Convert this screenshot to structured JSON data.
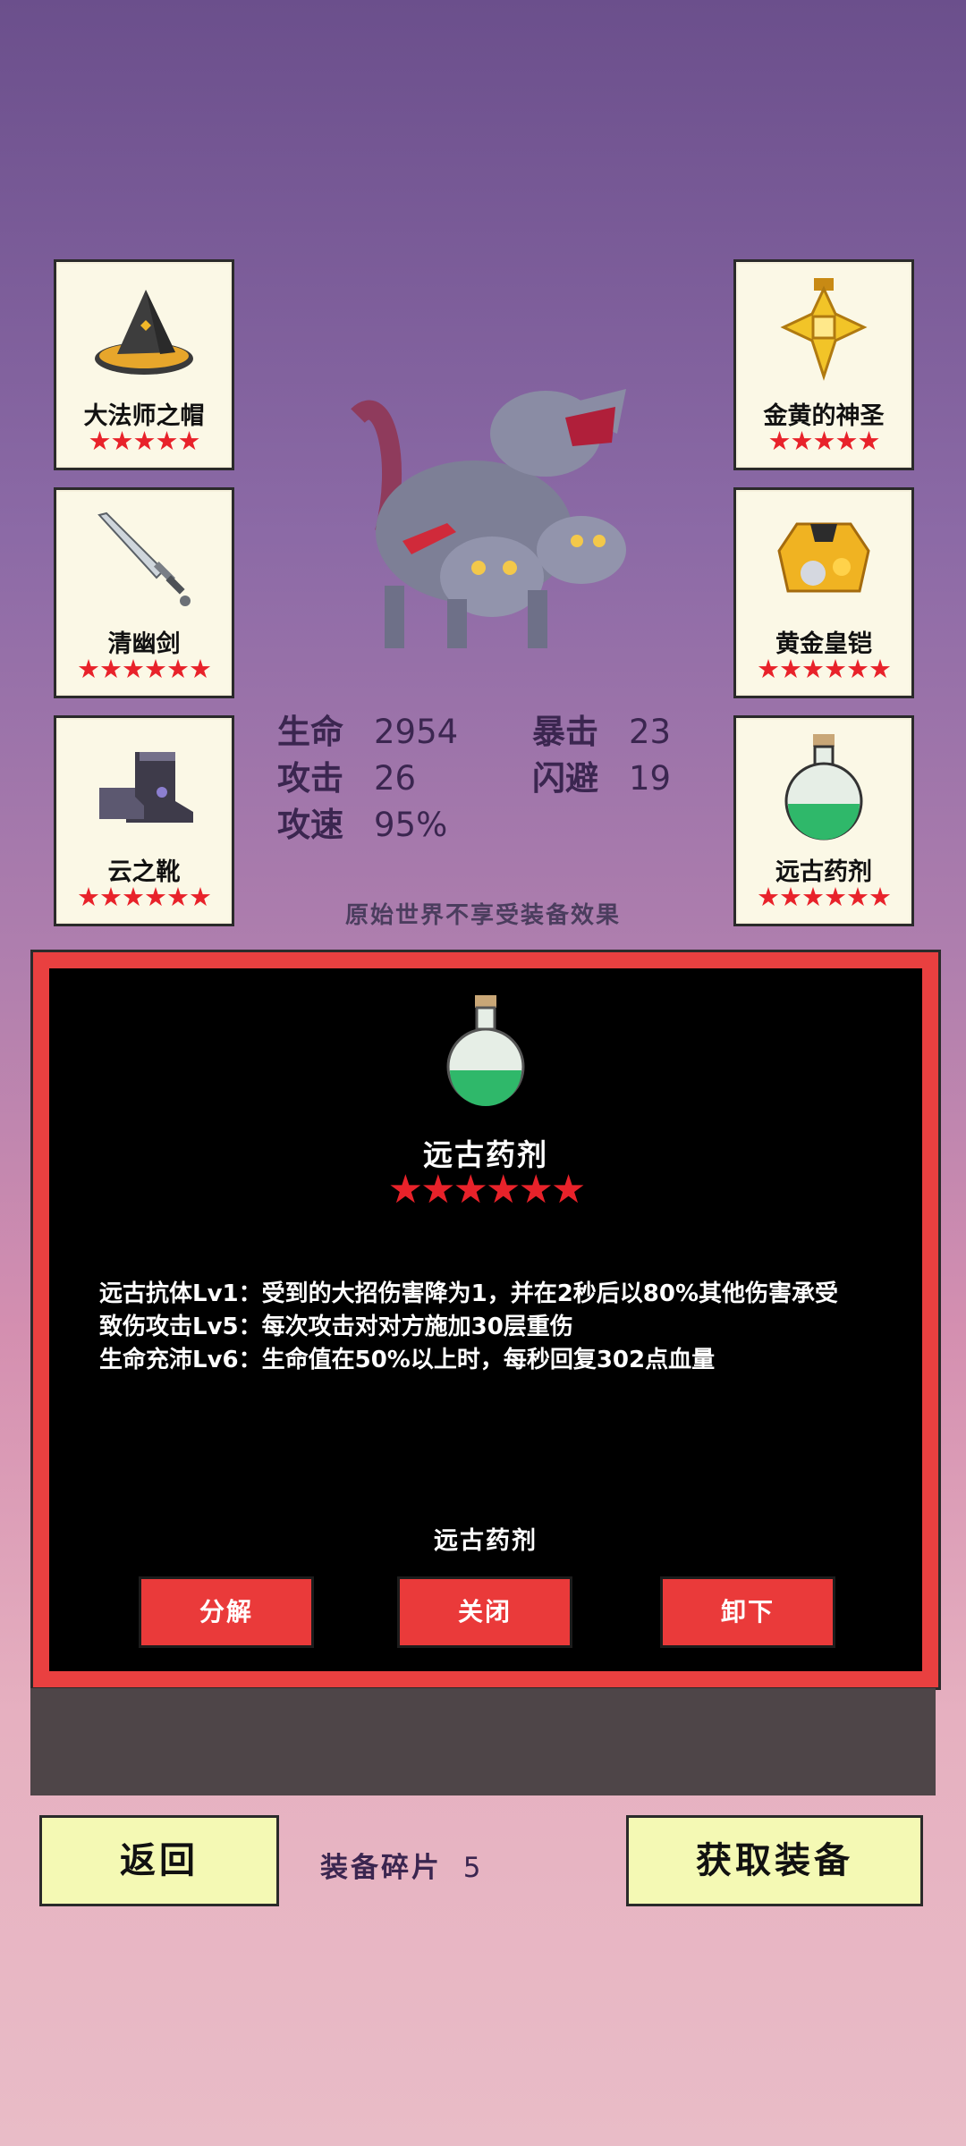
{
  "equipment_left": [
    {
      "name": "大法师之帽",
      "stars": "★★★★★",
      "icon": "wizard-hat-icon"
    },
    {
      "name": "清幽剑",
      "stars": "★★★★★★",
      "icon": "sword-icon"
    },
    {
      "name": "云之靴",
      "stars": "★★★★★★",
      "icon": "boots-icon"
    }
  ],
  "equipment_right": [
    {
      "name": "金黄的神圣",
      "stars": "★★★★★",
      "icon": "holy-cross-icon"
    },
    {
      "name": "黄金皇铠",
      "stars": "★★★★★★",
      "icon": "golden-armor-icon"
    },
    {
      "name": "远古药剂",
      "stars": "★★★★★★",
      "icon": "potion-icon"
    }
  ],
  "character": {
    "icon": "three-headed-dragon-icon"
  },
  "stats": {
    "hp_label": "生命",
    "hp_value": "2954",
    "crit_label": "暴击",
    "crit_value": "23",
    "atk_label": "攻击",
    "atk_value": "26",
    "dodge_label": "闪避",
    "dodge_value": "19",
    "spd_label": "攻速",
    "spd_value": "95%"
  },
  "notice": "原始世界不享受装备效果",
  "detail": {
    "title": "远古药剂",
    "stars": "★★★★★★",
    "lines": [
      "远古抗体Lv1：受到的大招伤害降为1，并在2秒后以80%其他伤害承受",
      "致伤攻击Lv5：每次攻击对对方施加30层重伤",
      "生命充沛Lv6：生命值在50%以上时，每秒回复302点血量"
    ],
    "name_footer": "远古药剂",
    "btn_decompose": "分解",
    "btn_close": "关闭",
    "btn_unequip": "卸下"
  },
  "bottom": {
    "back": "返回",
    "fragments_label": "装备碎片",
    "fragments_value": "5",
    "get_equipment": "获取装备"
  },
  "colors": {
    "accent_red": "#e8222a",
    "panel_red": "#e94040",
    "button_yellow": "#f4f9b4"
  }
}
